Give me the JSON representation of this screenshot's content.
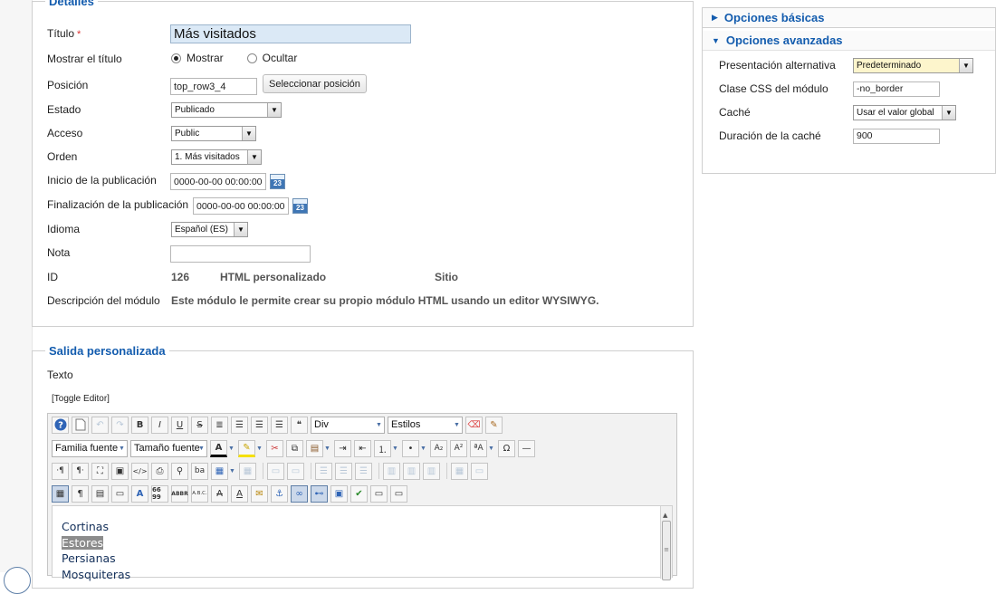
{
  "details": {
    "legend": "Detalles",
    "title_label": "Título",
    "required_mark": "*",
    "title_value": "Más visitados",
    "show_title_label": "Mostrar el título",
    "show_option": "Mostrar",
    "hide_option": "Ocultar",
    "position_label": "Posición",
    "position_value": "top_row3_4",
    "select_position_button": "Seleccionar posición",
    "state_label": "Estado",
    "state_value": "Publicado",
    "access_label": "Acceso",
    "access_value": "Public",
    "order_label": "Orden",
    "order_value": "1. Más visitados",
    "publish_up_label": "Inicio de la publicación",
    "publish_up_value": "0000-00-00 00:00:00",
    "publish_down_label": "Finalización de la publicación",
    "publish_down_value": "0000-00-00 00:00:00",
    "calendar_day": "23",
    "language_label": "Idioma",
    "language_value": "Español (ES)",
    "note_label": "Nota",
    "note_value": "",
    "id_label": "ID",
    "id_value": "126",
    "module_type": "HTML personalizado",
    "client": "Sitio",
    "desc_label": "Descripción del módulo",
    "desc_value": "Este módulo le permite crear su propio módulo HTML usando un editor WYSIWYG."
  },
  "options": {
    "basic_title": "Opciones básicas",
    "advanced_title": "Opciones avanzadas",
    "alt_layout_label": "Presentación alternativa",
    "alt_layout_value": "Predeterminado",
    "css_class_label": "Clase CSS del módulo",
    "css_class_value": "-no_border",
    "cache_label": "Caché",
    "cache_value": "Usar el valor global",
    "cache_time_label": "Duración de la caché",
    "cache_time_value": "900"
  },
  "custom_output": {
    "legend": "Salida personalizada",
    "text_label": "Texto",
    "toggle_editor": "[Toggle Editor]",
    "format_select": "Div",
    "styles_select": "Estilos",
    "font_family_select": "Familia fuente",
    "font_size_select": "Tamaño fuente",
    "content_lines": [
      "Cortinas",
      "Estores",
      "Persianas",
      "Mosquiteras"
    ]
  },
  "toolbar_glyphs": {
    "bold": "B",
    "italic": "I",
    "underline": "U",
    "strike": "S",
    "subscript": "A₂",
    "superscript": "A²",
    "omega": "Ω",
    "pilcrow_ltr": "·¶",
    "pilcrow_rtl": "¶·",
    "cite": "«»",
    "abbr": "ABBR",
    "acronym": "A.B.C.",
    "quote": "66 99"
  },
  "colors": {
    "accent": "#135cae",
    "title_bg": "#dbe9f6",
    "alt_layout_bg": "#fdf5cc"
  }
}
